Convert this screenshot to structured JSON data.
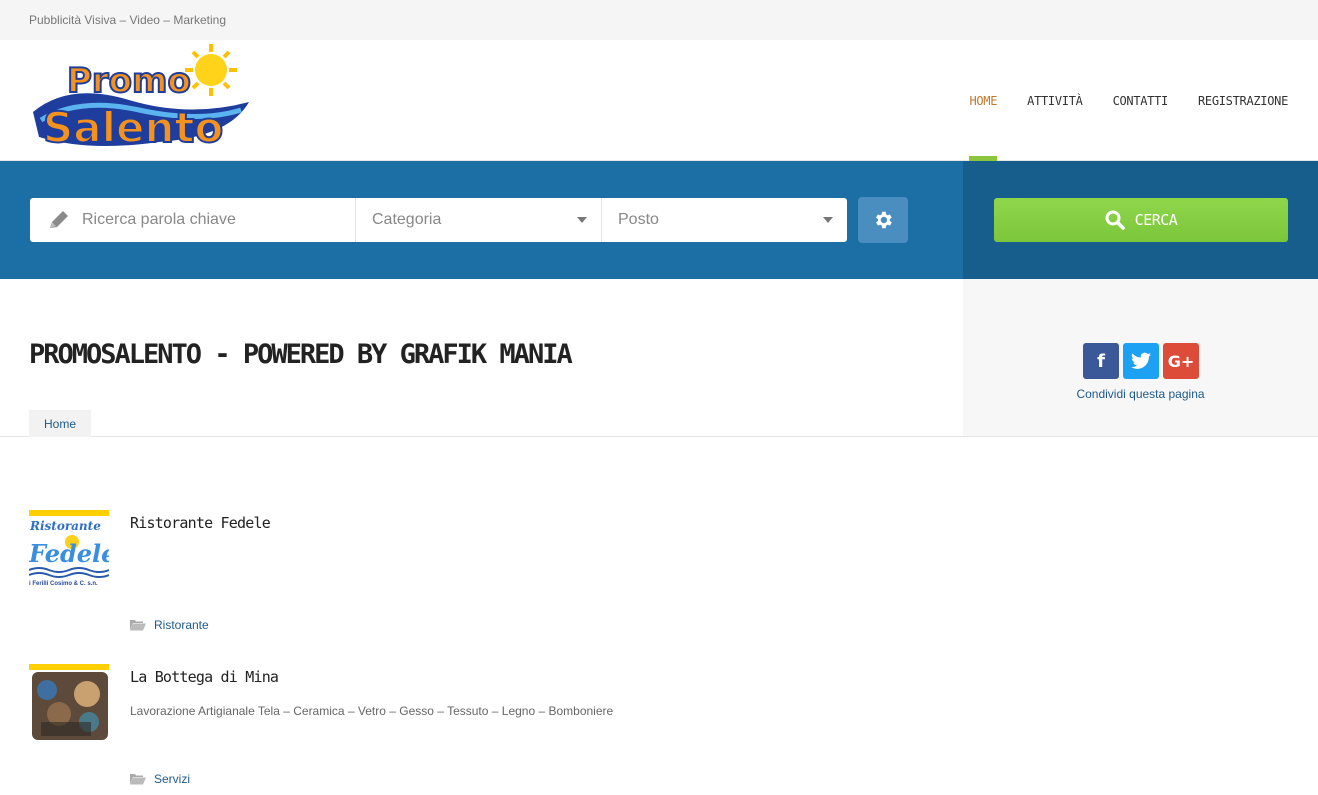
{
  "topbar": {
    "tagline": "Pubblicità Visiva – Video – Marketing"
  },
  "logo": {
    "line1": "Promo",
    "line2": "Salento"
  },
  "nav": [
    {
      "label": "Home",
      "active": true
    },
    {
      "label": "Attività",
      "active": false
    },
    {
      "label": "Contatti",
      "active": false
    },
    {
      "label": "Registrazione",
      "active": false
    }
  ],
  "search": {
    "keyword_placeholder": "Ricerca parola chiave",
    "category_label": "Categoria",
    "place_label": "Posto",
    "submit_label": "CERCA"
  },
  "page": {
    "title": "PROMOSALENTO - POWERED BY GRAFIK MANIA",
    "breadcrumb": "Home"
  },
  "share": {
    "label": "Condividi questa pagina"
  },
  "listings": [
    {
      "title": "Ristorante Fedele",
      "description": "",
      "category": "Ristorante",
      "thumb_text": "Ristorante",
      "thumb_brand": "Fedele",
      "thumb_sub": "i Ferilli Cosimo & C. s.n."
    },
    {
      "title": "La Bottega di Mina",
      "description": "Lavorazione Artigianale Tela – Ceramica – Vetro – Gesso – Tessuto – Legno – Bomboniere",
      "category": "Servizi"
    }
  ],
  "colors": {
    "primary": "#1c6fa4",
    "accent": "#8cc63f",
    "nav_active": "#c0782a"
  }
}
